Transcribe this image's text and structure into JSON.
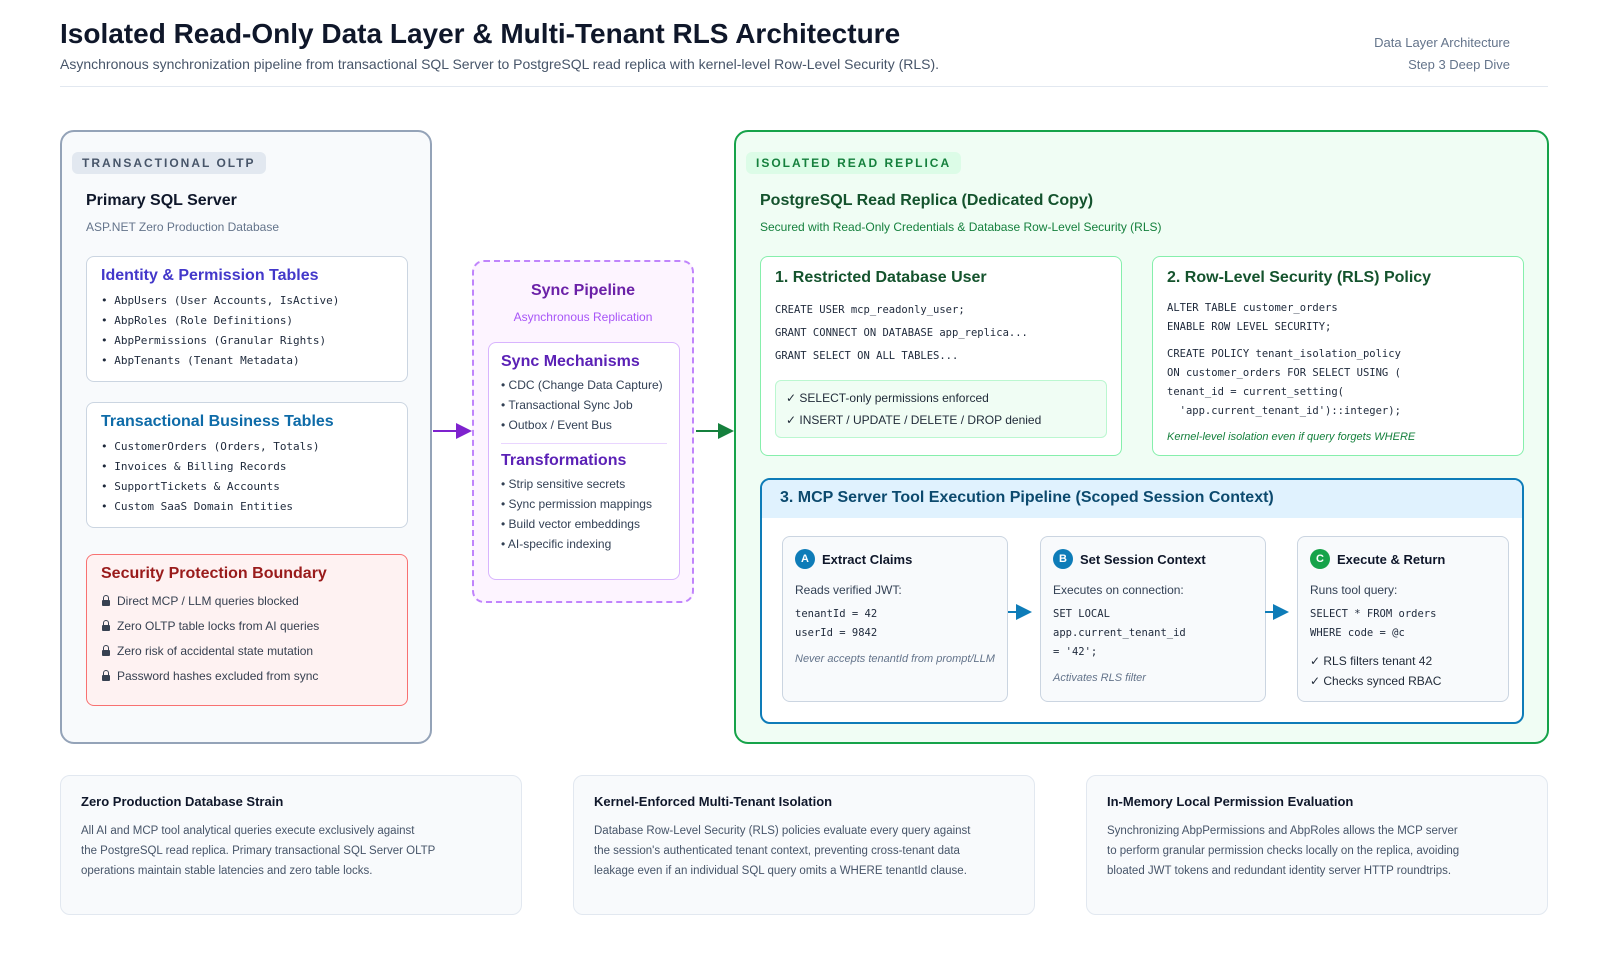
{
  "header": {
    "title": "Isolated Read-Only Data Layer & Multi-Tenant RLS Architecture",
    "subtitle": "Asynchronous synchronization pipeline from transactional SQL Server to PostgreSQL read replica with kernel-level Row-Level Security (RLS).",
    "meta_line1": "Data Layer Architecture",
    "meta_line2": "Step 3 Deep Dive"
  },
  "oltp": {
    "tag": "TRANSACTIONAL OLTP",
    "title": "Primary SQL Server",
    "subtitle": "ASP.NET Zero Production Database",
    "identity": {
      "title": "Identity & Permission Tables",
      "items": [
        "AbpUsers (User Accounts, IsActive)",
        "AbpRoles (Role Definitions)",
        "AbpPermissions (Granular Rights)",
        "AbpTenants (Tenant Metadata)"
      ]
    },
    "business": {
      "title": "Transactional Business Tables",
      "items": [
        "CustomerOrders (Orders, Totals)",
        "Invoices & Billing Records",
        "SupportTickets & Accounts",
        "Custom SaaS Domain Entities"
      ]
    },
    "security": {
      "title": "Security Protection Boundary",
      "items": [
        "Direct MCP / LLM queries blocked",
        "Zero OLTP table locks from AI queries",
        "Zero risk of accidental state mutation",
        "Password hashes excluded from sync"
      ]
    }
  },
  "sync": {
    "title": "Sync Pipeline",
    "subtitle": "Asynchronous Replication",
    "mechanisms_title": "Sync Mechanisms",
    "mechanisms": [
      "CDC (Change Data Capture)",
      "Transactional Sync Job",
      "Outbox / Event Bus"
    ],
    "transforms_title": "Transformations",
    "transforms": [
      "Strip sensitive secrets",
      "Sync permission mappings",
      "Build vector embeddings",
      "AI-specific indexing"
    ]
  },
  "replica": {
    "tag": "ISOLATED READ REPLICA",
    "title": "PostgreSQL Read Replica (Dedicated Copy)",
    "subtitle": "Secured with Read-Only Credentials & Database Row-Level Security (RLS)",
    "user_card": {
      "title": "1. Restricted Database User",
      "code": [
        "CREATE USER mcp_readonly_user;",
        "GRANT CONNECT ON DATABASE app_replica...",
        "GRANT SELECT ON ALL TABLES..."
      ],
      "checks": [
        "✓ SELECT-only permissions enforced",
        "✓ INSERT / UPDATE / DELETE / DROP denied"
      ]
    },
    "rls_card": {
      "title": "2. Row-Level Security (RLS) Policy",
      "code_a": [
        "ALTER TABLE customer_orders",
        "ENABLE ROW LEVEL SECURITY;"
      ],
      "code_b": [
        "CREATE POLICY tenant_isolation_policy",
        "ON customer_orders FOR SELECT USING (",
        "tenant_id = current_setting(",
        "  'app.current_tenant_id')::integer);"
      ],
      "note": "Kernel-level isolation even if query forgets WHERE"
    },
    "mcp": {
      "title": "3. MCP Server Tool Execution Pipeline (Scoped Session Context)",
      "steps": [
        {
          "badge": "A",
          "title": "Extract Claims",
          "text": "Reads verified JWT:",
          "code": "tenantId = 42\nuserId = 9842",
          "note": "Never accepts tenantId from prompt/LLM"
        },
        {
          "badge": "B",
          "title": "Set Session Context",
          "text": "Executes on connection:",
          "code": "SET LOCAL\napp.current_tenant_id\n= '42';",
          "note": "Activates RLS filter"
        },
        {
          "badge": "C",
          "title": "Execute & Return",
          "text": "Runs tool query:",
          "code": "SELECT * FROM orders\nWHERE code = @c",
          "checks": [
            "✓ RLS filters tenant 42",
            "✓ Checks synced RBAC"
          ]
        }
      ]
    }
  },
  "benefits": [
    {
      "title": "Zero Production Database Strain",
      "lines": [
        "All AI and MCP tool analytical queries execute exclusively against",
        "the PostgreSQL read replica. Primary transactional SQL Server OLTP",
        "operations maintain stable latencies and zero table locks."
      ]
    },
    {
      "title": "Kernel-Enforced Multi-Tenant Isolation",
      "lines": [
        "Database Row-Level Security (RLS) policies evaluate every query against",
        "the session's authenticated tenant context, preventing cross-tenant data",
        "leakage even if an individual SQL query omits a WHERE tenantId clause."
      ]
    },
    {
      "title": "In-Memory Local Permission Evaluation",
      "lines": [
        "Synchronizing AbpPermissions and AbpRoles allows the MCP server",
        "to perform granular permission checks locally on the replica, avoiding",
        "bloated JWT tokens and redundant identity server HTTP roundtrips."
      ]
    }
  ],
  "colors": {
    "oltp_border": "#94a3b8",
    "sync_accent": "#a855f7",
    "replica_accent": "#16a34a",
    "mcp_accent": "#0e7cb8",
    "security_accent": "#f87171"
  }
}
